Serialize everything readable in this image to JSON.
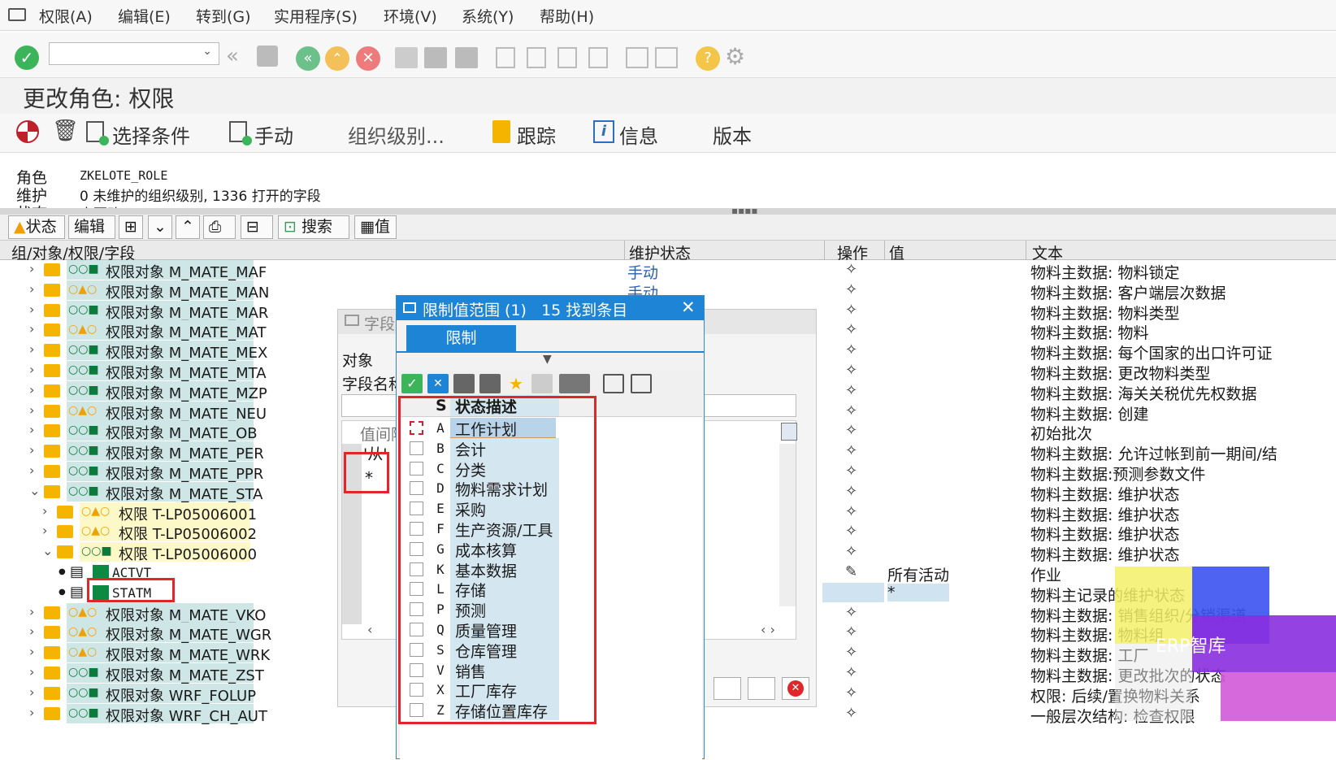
{
  "menu": [
    "权限(A)",
    "编辑(E)",
    "转到(G)",
    "实用程序(S)",
    "环境(V)",
    "系统(Y)",
    "帮助(H)"
  ],
  "title": "更改角色: 权限",
  "app_toolbar": {
    "select_criteria": "选择条件",
    "manual": "手动",
    "org_levels": "组织级别...",
    "trace": "跟踪",
    "info": "信息",
    "version": "版本"
  },
  "header": {
    "role_label": "角色",
    "role_value": "ZKELOTE_ROLE",
    "maint_label": "维护",
    "maint_value": "0 未维护的组织级别,  1336 打开的字段",
    "status_label": "状态",
    "status_value": "未更改"
  },
  "toolbar2": {
    "status": "状态",
    "edit": "编辑",
    "search": "搜索",
    "value": "值"
  },
  "columns": {
    "tree": "组/对象/权限/字段",
    "maint_status": "维护状态",
    "op": "操作",
    "value": "值",
    "text": "文本"
  },
  "rows": [
    {
      "name": "权限对象 M_MATE_MAF",
      "status": "○○■",
      "text": "物料主数据: 物料锁定",
      "maint": "手动"
    },
    {
      "name": "权限对象 M_MATE_MAN",
      "status": "○▲○",
      "text": "物料主数据: 客户端层次数据",
      "maint": "手动"
    },
    {
      "name": "权限对象 M_MATE_MAR",
      "status": "○○■",
      "text": "物料主数据: 物料类型",
      "maint": ""
    },
    {
      "name": "权限对象 M_MATE_MAT",
      "status": "○▲○",
      "text": "物料主数据: 物料",
      "maint": ""
    },
    {
      "name": "权限对象 M_MATE_MEX",
      "status": "○○■",
      "text": "物料主数据: 每个国家的出口许可证",
      "maint": ""
    },
    {
      "name": "权限对象 M_MATE_MTA",
      "status": "○○■",
      "text": "物料主数据: 更改物料类型",
      "maint": ""
    },
    {
      "name": "权限对象 M_MATE_MZP",
      "status": "○○■",
      "text": "物料主数据: 海关关税优先权数据",
      "maint": ""
    },
    {
      "name": "权限对象 M_MATE_NEU",
      "status": "○▲○",
      "text": "物料主数据: 创建",
      "maint": ""
    },
    {
      "name": "权限对象 M_MATE_OB",
      "status": "○○■",
      "text": "初始批次",
      "maint": ""
    },
    {
      "name": "权限对象 M_MATE_PER",
      "status": "○○■",
      "text": "物料主数据: 允许过帐到前一期间/结",
      "maint": ""
    },
    {
      "name": "权限对象 M_MATE_PPR",
      "status": "○○■",
      "text": "物料主数据:预测参数文件",
      "maint": ""
    },
    {
      "name": "权限对象 M_MATE_STA",
      "status": "○○■",
      "text": "物料主数据: 维护状态",
      "maint": ""
    },
    {
      "name": "权限 T-LP05006001",
      "status": "○▲○",
      "text": "物料主数据: 维护状态",
      "maint": ""
    },
    {
      "name": "权限 T-LP05006002",
      "status": "○▲○",
      "text": "物料主数据: 维护状态",
      "maint": ""
    },
    {
      "name": "权限 T-LP05006000",
      "status": "○○■",
      "text": "物料主数据: 维护状态",
      "maint": ""
    },
    {
      "name": "ACTVT",
      "status": "",
      "text": "作业",
      "value": "所有活动",
      "maint": ""
    },
    {
      "name": "STATM",
      "status": "",
      "text": "物料主记录的维护状态",
      "value": "*",
      "maint": ""
    },
    {
      "name": "权限对象 M_MATE_VKO",
      "status": "○▲○",
      "text": "物料主数据: 销售组织/分销渠道",
      "maint": ""
    },
    {
      "name": "权限对象 M_MATE_WGR",
      "status": "○▲○",
      "text": "物料主数据: 物料组",
      "maint": ""
    },
    {
      "name": "权限对象 M_MATE_WRK",
      "status": "○▲○",
      "text": "物料主数据: 工厂",
      "maint": ""
    },
    {
      "name": "权限对象 M_MATE_ZST",
      "status": "○○■",
      "text": "物料主数据: 更改批次的状态",
      "maint": ""
    },
    {
      "name": "权限对象 WRF_FOLUP",
      "status": "○○■",
      "text": "权限: 后续/置换物料关系",
      "maint": ""
    },
    {
      "name": "权限对象 WRF_CH_AUT",
      "status": "○○■",
      "text": "一般层次结构: 检查权限",
      "maint": ""
    }
  ],
  "bg_dialog": {
    "title": "字段",
    "object_label": "对象",
    "field_label": "字段名称",
    "interval_label": "值间隔",
    "from_label": "'从'",
    "value": "*"
  },
  "dialog": {
    "title": "限制值范围 (1)   15 找到条目",
    "tab": "限制",
    "col_s": "S",
    "col_desc": "状态描述",
    "items": [
      {
        "code": "A",
        "desc": "工作计划"
      },
      {
        "code": "B",
        "desc": "会计"
      },
      {
        "code": "C",
        "desc": "分类"
      },
      {
        "code": "D",
        "desc": "物料需求计划"
      },
      {
        "code": "E",
        "desc": "采购"
      },
      {
        "code": "F",
        "desc": "生产资源/工具"
      },
      {
        "code": "G",
        "desc": "成本核算"
      },
      {
        "code": "K",
        "desc": "基本数据"
      },
      {
        "code": "L",
        "desc": "存储"
      },
      {
        "code": "P",
        "desc": "预测"
      },
      {
        "code": "Q",
        "desc": "质量管理"
      },
      {
        "code": "S",
        "desc": "仓库管理"
      },
      {
        "code": "V",
        "desc": "销售"
      },
      {
        "code": "X",
        "desc": "工厂库存"
      },
      {
        "code": "Z",
        "desc": "存储位置库存"
      }
    ]
  },
  "watermark": "ERP智库",
  "colors": {
    "sap_blue": "#1d84d6",
    "highlight_red": "#e0262b",
    "folder": "#f5b400",
    "green_ok": "#3cb55a"
  }
}
